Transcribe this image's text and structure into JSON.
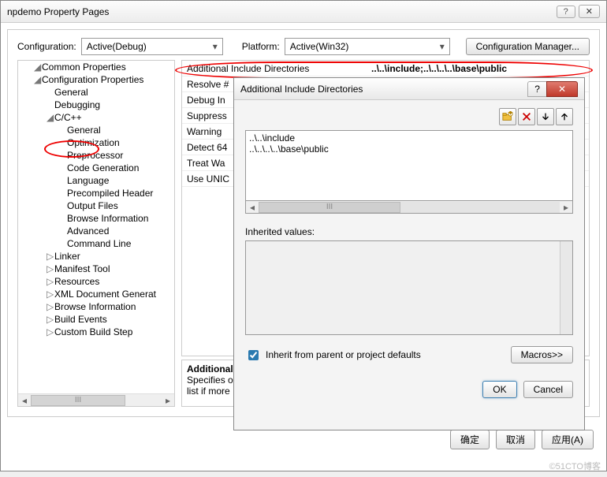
{
  "outer_window": {
    "title": "npdemo Property Pages",
    "help": "?",
    "close": "✕"
  },
  "config_row": {
    "configuration_label": "Configuration:",
    "configuration_value": "Active(Debug)",
    "platform_label": "Platform:",
    "platform_value": "Active(Win32)",
    "manager_button": "Configuration Manager..."
  },
  "tree": {
    "items": [
      {
        "level": 0,
        "exp": "◢",
        "label": "Common Properties"
      },
      {
        "level": 0,
        "exp": "◢",
        "label": "Configuration Properties"
      },
      {
        "level": 1,
        "exp": "",
        "label": "General"
      },
      {
        "level": 1,
        "exp": "",
        "label": "Debugging"
      },
      {
        "level": 1,
        "exp": "◢",
        "label": "C/C++"
      },
      {
        "level": 2,
        "exp": "",
        "label": "General"
      },
      {
        "level": 2,
        "exp": "",
        "label": "Optimization"
      },
      {
        "level": 2,
        "exp": "",
        "label": "Preprocessor"
      },
      {
        "level": 2,
        "exp": "",
        "label": "Code Generation"
      },
      {
        "level": 2,
        "exp": "",
        "label": "Language"
      },
      {
        "level": 2,
        "exp": "",
        "label": "Precompiled Header"
      },
      {
        "level": 2,
        "exp": "",
        "label": "Output Files"
      },
      {
        "level": 2,
        "exp": "",
        "label": "Browse Information"
      },
      {
        "level": 2,
        "exp": "",
        "label": "Advanced"
      },
      {
        "level": 2,
        "exp": "",
        "label": "Command Line"
      },
      {
        "level": 1,
        "exp": "▷",
        "label": "Linker"
      },
      {
        "level": 1,
        "exp": "▷",
        "label": "Manifest Tool"
      },
      {
        "level": 1,
        "exp": "▷",
        "label": "Resources"
      },
      {
        "level": 1,
        "exp": "▷",
        "label": "XML Document Generat"
      },
      {
        "level": 1,
        "exp": "▷",
        "label": "Browse Information"
      },
      {
        "level": 1,
        "exp": "▷",
        "label": "Build Events"
      },
      {
        "level": 1,
        "exp": "▷",
        "label": "Custom Build Step"
      }
    ],
    "scroll_marker": "III"
  },
  "properties": {
    "rows": [
      {
        "name": "Additional Include Directories",
        "value": "..\\..\\include;..\\..\\..\\..\\base\\public"
      },
      {
        "name": "Resolve #",
        "value": ""
      },
      {
        "name": "Debug In",
        "value": ""
      },
      {
        "name": "Suppress",
        "value": ""
      },
      {
        "name": "Warning",
        "value": ""
      },
      {
        "name": "Detect 64",
        "value": ""
      },
      {
        "name": "Treat Wa",
        "value": ""
      },
      {
        "name": "Use UNIC",
        "value": ""
      }
    ],
    "description": {
      "title": "Additional",
      "line1": "Specifies or",
      "line2": "list if more"
    }
  },
  "modal": {
    "title": "Additional Include Directories",
    "help": "?",
    "close": "✕",
    "icons": {
      "new": "new-folder-icon",
      "delete": "delete-icon",
      "down": "down-arrow-icon",
      "up": "up-arrow-icon"
    },
    "list_items": [
      "..\\..\\include",
      "..\\..\\..\\..\\base\\public"
    ],
    "scroll_marker": "III",
    "inherited_label": "Inherited values:",
    "inherit_checkbox": "Inherit from parent or project defaults",
    "inherit_checked": true,
    "macros_button": "Macros>>",
    "ok": "OK",
    "cancel": "Cancel"
  },
  "footer": {
    "ok": "确定",
    "cancel": "取消",
    "apply": "应用(A)"
  },
  "watermark": "©51CTO博客"
}
